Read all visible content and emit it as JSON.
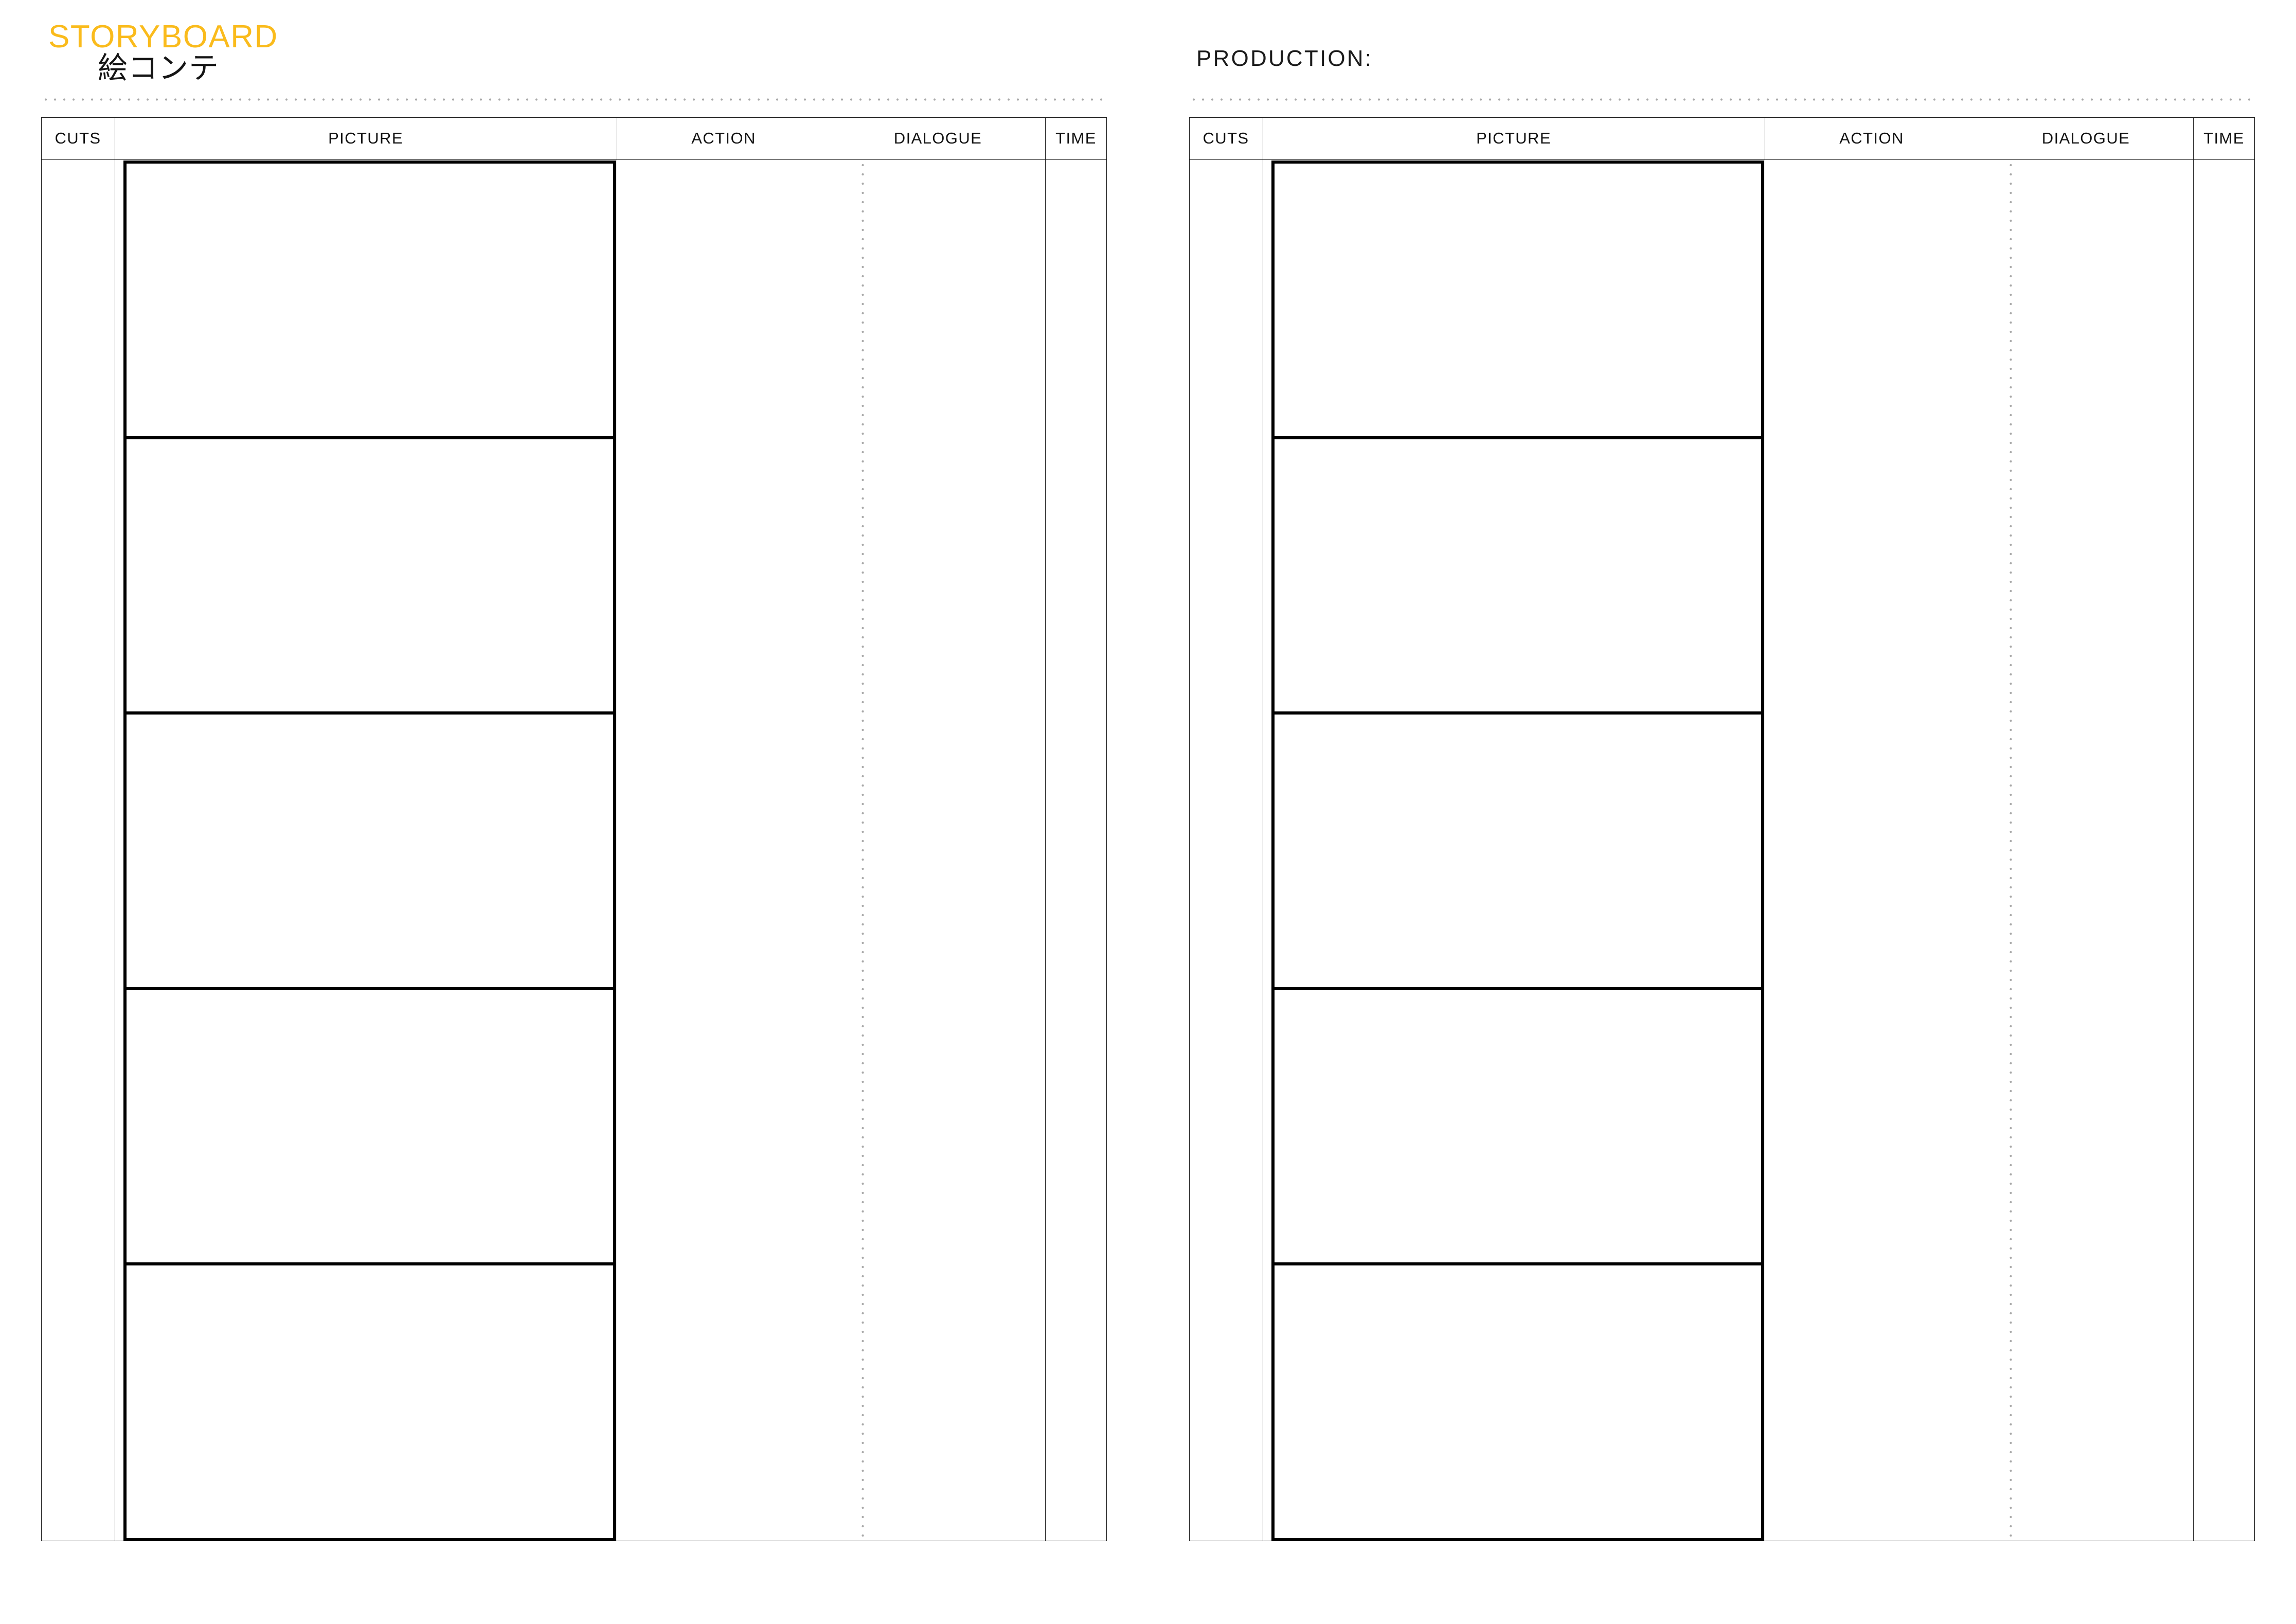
{
  "document": {
    "type": "storyboard-template",
    "background_color": "#ffffff",
    "panel_count": 2
  },
  "theme": {
    "accent_color": "#fabb1c",
    "text_color": "#111111",
    "rule_color": "#1a1a1a",
    "dotted_rule_color": "#a8a8a8",
    "frame_border_color": "#000000"
  },
  "panels": [
    {
      "id": "left",
      "header": {
        "title_en": "STORYBOARD",
        "title_jp": "絵コンテ",
        "production_label": null
      },
      "table": {
        "columns": [
          {
            "key": "cuts",
            "label": "CUTS"
          },
          {
            "key": "picture",
            "label": "PICTURE"
          },
          {
            "key": "action",
            "label": "ACTION"
          },
          {
            "key": "dialogue",
            "label": "DIALOGUE"
          },
          {
            "key": "time",
            "label": "TIME"
          }
        ],
        "frame_count": 5,
        "rows": [
          {
            "cuts": "",
            "picture": "",
            "action": "",
            "dialogue": "",
            "time": ""
          },
          {
            "cuts": "",
            "picture": "",
            "action": "",
            "dialogue": "",
            "time": ""
          },
          {
            "cuts": "",
            "picture": "",
            "action": "",
            "dialogue": "",
            "time": ""
          },
          {
            "cuts": "",
            "picture": "",
            "action": "",
            "dialogue": "",
            "time": ""
          },
          {
            "cuts": "",
            "picture": "",
            "action": "",
            "dialogue": "",
            "time": ""
          }
        ]
      }
    },
    {
      "id": "right",
      "header": {
        "title_en": null,
        "title_jp": null,
        "production_label": "PRODUCTION:"
      },
      "table": {
        "columns": [
          {
            "key": "cuts",
            "label": "CUTS"
          },
          {
            "key": "picture",
            "label": "PICTURE"
          },
          {
            "key": "action",
            "label": "ACTION"
          },
          {
            "key": "dialogue",
            "label": "DIALOGUE"
          },
          {
            "key": "time",
            "label": "TIME"
          }
        ],
        "frame_count": 5,
        "rows": [
          {
            "cuts": "",
            "picture": "",
            "action": "",
            "dialogue": "",
            "time": ""
          },
          {
            "cuts": "",
            "picture": "",
            "action": "",
            "dialogue": "",
            "time": ""
          },
          {
            "cuts": "",
            "picture": "",
            "action": "",
            "dialogue": "",
            "time": ""
          },
          {
            "cuts": "",
            "picture": "",
            "action": "",
            "dialogue": "",
            "time": ""
          },
          {
            "cuts": "",
            "picture": "",
            "action": "",
            "dialogue": "",
            "time": ""
          }
        ]
      }
    }
  ]
}
